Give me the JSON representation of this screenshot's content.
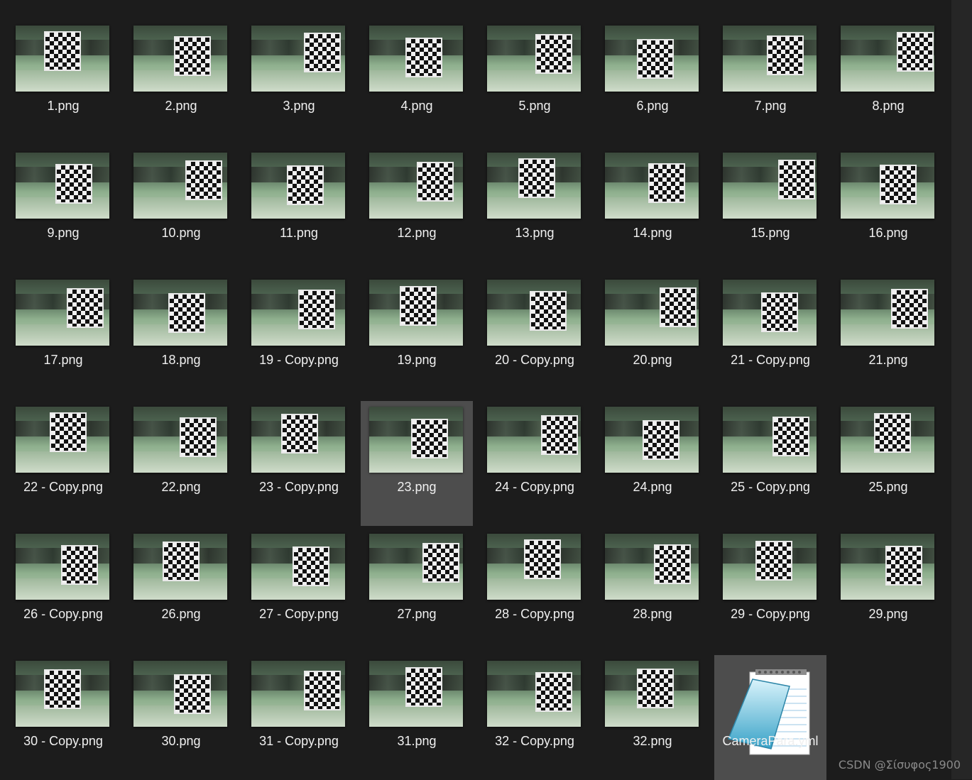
{
  "files": [
    {
      "name": "1.png",
      "type": "image"
    },
    {
      "name": "2.png",
      "type": "image"
    },
    {
      "name": "3.png",
      "type": "image"
    },
    {
      "name": "4.png",
      "type": "image"
    },
    {
      "name": "5.png",
      "type": "image"
    },
    {
      "name": "6.png",
      "type": "image"
    },
    {
      "name": "7.png",
      "type": "image"
    },
    {
      "name": "8.png",
      "type": "image"
    },
    {
      "name": "9.png",
      "type": "image"
    },
    {
      "name": "10.png",
      "type": "image"
    },
    {
      "name": "11.png",
      "type": "image"
    },
    {
      "name": "12.png",
      "type": "image"
    },
    {
      "name": "13.png",
      "type": "image"
    },
    {
      "name": "14.png",
      "type": "image"
    },
    {
      "name": "15.png",
      "type": "image"
    },
    {
      "name": "16.png",
      "type": "image"
    },
    {
      "name": "17.png",
      "type": "image"
    },
    {
      "name": "18.png",
      "type": "image"
    },
    {
      "name": "19 - Copy.png",
      "type": "image"
    },
    {
      "name": "19.png",
      "type": "image"
    },
    {
      "name": "20 - Copy.png",
      "type": "image"
    },
    {
      "name": "20.png",
      "type": "image"
    },
    {
      "name": "21 - Copy.png",
      "type": "image"
    },
    {
      "name": "21.png",
      "type": "image"
    },
    {
      "name": "22 - Copy.png",
      "type": "image"
    },
    {
      "name": "22.png",
      "type": "image"
    },
    {
      "name": "23 - Copy.png",
      "type": "image"
    },
    {
      "name": "23.png",
      "type": "image",
      "selected": true
    },
    {
      "name": "24 - Copy.png",
      "type": "image"
    },
    {
      "name": "24.png",
      "type": "image"
    },
    {
      "name": "25 - Copy.png",
      "type": "image"
    },
    {
      "name": "25.png",
      "type": "image"
    },
    {
      "name": "26 - Copy.png",
      "type": "image"
    },
    {
      "name": "26.png",
      "type": "image"
    },
    {
      "name": "27 - Copy.png",
      "type": "image"
    },
    {
      "name": "27.png",
      "type": "image"
    },
    {
      "name": "28 - Copy.png",
      "type": "image"
    },
    {
      "name": "28.png",
      "type": "image"
    },
    {
      "name": "29 - Copy.png",
      "type": "image"
    },
    {
      "name": "29.png",
      "type": "image"
    },
    {
      "name": "30 - Copy.png",
      "type": "image"
    },
    {
      "name": "30.png",
      "type": "image"
    },
    {
      "name": "31 - Copy.png",
      "type": "image"
    },
    {
      "name": "31.png",
      "type": "image"
    },
    {
      "name": "32 - Copy.png",
      "type": "image"
    },
    {
      "name": "32.png",
      "type": "image"
    },
    {
      "name": "CameraPara.yml",
      "type": "notepad-document",
      "icon": "notepad-icon",
      "selected": true
    }
  ],
  "watermark": "CSDN @Σίσυφος1900",
  "colors": {
    "background": "#1c1c1c",
    "selection": "#4d4d4d",
    "text": "#f0f0f0"
  }
}
